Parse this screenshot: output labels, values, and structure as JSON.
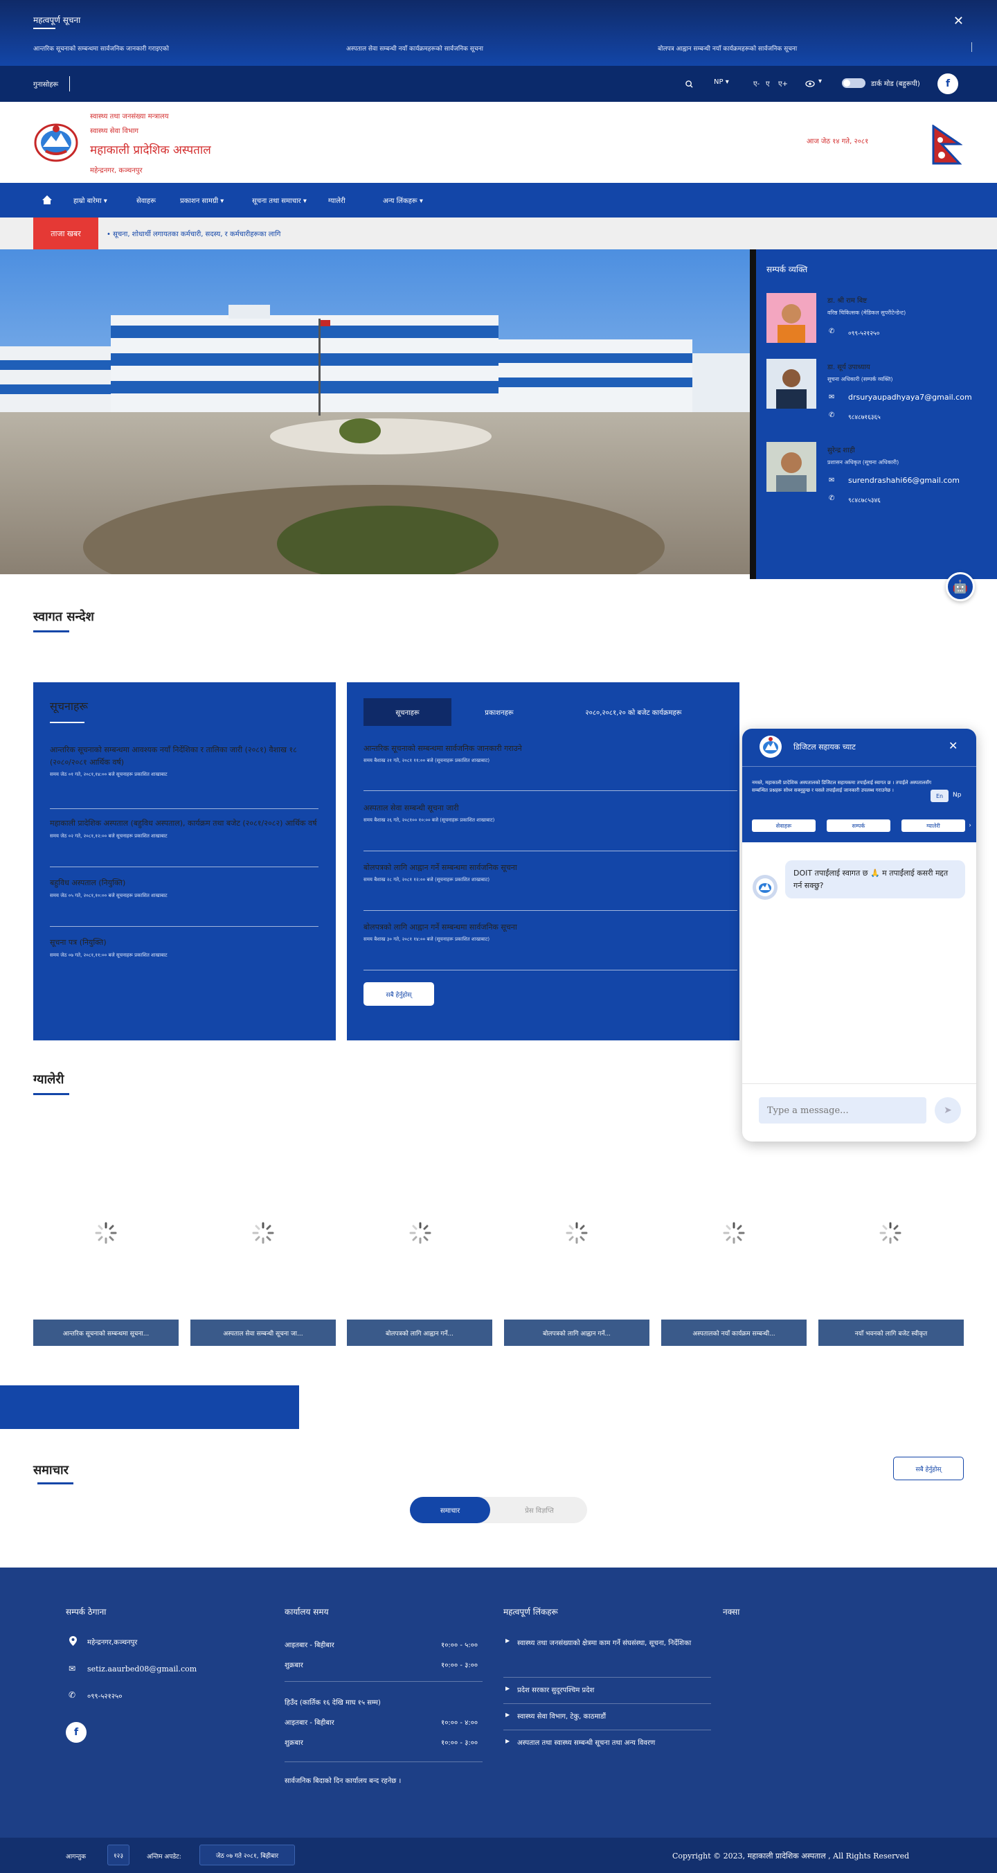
{
  "notice": {
    "title": "महत्वपूर्ण सूचना",
    "items": [
      "आन्तरिक सूचनाको सम्बन्धमा सार्वजनिक जानकारी गराइएको",
      "अस्पताल सेवा सम्बन्धी नयाँ कार्यक्रमहरूको सार्वजनिक सूचना",
      "बोलपत्र आह्वान सम्बन्धी नयाँ कार्यक्रमहरूको सार्वजनिक सूचना"
    ],
    "close": "✕"
  },
  "utility": {
    "left_label": "गुनासोहरू",
    "search_icon": "search-icon",
    "lang": "NP ▾",
    "font_sizes": [
      "ए-",
      "ए",
      "ए+"
    ],
    "eye_icon": "eye-icon",
    "toggle_label": "डार्क मोड (बहुरूपी)",
    "facebook": "f"
  },
  "header": {
    "line1": "स्वास्थ्य तथा जनसंख्या मन्त्रालय",
    "line2": "स्वास्थ्य सेवा विभाग",
    "title": "महाकाली प्रादेशिक अस्पताल",
    "location": "महेन्द्रनगर, कञ्चनपुर",
    "date": "आज जेठ १४ गते, २०८१"
  },
  "nav": {
    "home_icon": "home-icon",
    "items": [
      "हाम्रो बारेमा ▾",
      "सेवाहरू",
      "प्रकाशन सामग्री ▾",
      "सूचना तथा समाचार ▾",
      "ग्यालेरी",
      "अन्य लिंकहरू ▾"
    ]
  },
  "ticker": {
    "label": "ताजा खबर",
    "text": "• सूचना, शोधार्थी लगायतका कर्मचारी, सदस्य, र कर्मचारीहरूका लागि"
  },
  "side_panel": {
    "title": "सम्पर्क व्यक्ति",
    "people": [
      {
        "name": "डा. श्री राम बिष्ट",
        "role": "वरिष्ठ चिकित्सक (मेडिकल सुपरीटेन्डेन्ट)",
        "email": "",
        "phone": "०९९-५२१२५०"
      },
      {
        "name": "डा. सूर्य उपाध्याय",
        "role": "सूचना अधिकारी (सम्पर्क व्यक्ति)",
        "email": "drsuryaupadhyaya7@gmail.com",
        "phone": "९८४८७१६३६५"
      },
      {
        "name": "सुरेन्द्र शाही",
        "role": "प्रशासन अधिकृत (सूचना अधिकारी)",
        "email": "surendrashahi66@gmail.com",
        "phone": "९८४८७८५३४६"
      }
    ]
  },
  "welcome": {
    "title": "स्वागत सन्देश"
  },
  "notices_panel": {
    "title": "सूचनाहरू",
    "items": [
      {
        "head": "आन्तरिक सूचनाको सम्बन्धमा आवश्यक नयाँ निर्देशिका र तालिका जारी (२०८१) वैशाख १८ (२०८०/२०८१ आर्थिक वर्ष)",
        "meta": "समय जेठ ०१ गते, २०८१,१४:०० बजे    सूचनाहरू प्रकाशित शाखाबाट"
      },
      {
        "head": "महाकाली प्रादेशिक अस्पताल (बहुविध अस्पताल), कार्यक्रम तथा बजेट (२०८१/२०८२) आर्थिक वर्ष",
        "meta": "समय जेठ ०२ गते, २०८१,१२:०० बजे    सूचनाहरू प्रकाशित शाखाबाट"
      },
      {
        "head": "बहुविध अस्पताल (नियुक्ति)",
        "meta": "समय जेठ ०५ गते, २०८१,१०:०० बजे    सूचनाहरू प्रकाशित शाखाबाट"
      },
      {
        "head": "सूचना पत्र (नियुक्ति)",
        "meta": "समय जेठ ०७ गते, २०८१,११:०० बजे    सूचनाहरू प्रकाशित शाखाबाट"
      }
    ]
  },
  "tabs_panel": {
    "tabs": [
      "सूचनाहरू",
      "प्रकाशनहरू",
      "२०८०,२०८१,२० को बजेट कार्यक्रमहरू"
    ],
    "items": [
      {
        "head": "आन्तरिक सूचनाको सम्बन्धमा सार्वजनिक जानकारी गराउने",
        "meta": "समय बैशाख २१ गते, २०८१ ११:०० बजे (सूचनाहरू प्रकाशित शाखाबाट)"
      },
      {
        "head": "अस्पताल सेवा सम्बन्धी सूचना जारी",
        "meta": "समय बैशाख २६ गते, २०८१०० १०:०० बजे (सूचनाहरू प्रकाशित शाखाबाट)"
      },
      {
        "head": "बोलपत्रको लागि आह्वान गर्ने सम्बन्धमा सार्वजनिक सूचना",
        "meta": "समय बैशाख २८ गते, २०८१ १२:०० बजे (सूचनाहरू प्रकाशित शाखाबाट)"
      },
      {
        "head": "बोलपत्रको लागि आह्वान गर्ने सम्बन्धमा सार्वजनिक सूचना",
        "meta": "समय बैशाख ३० गते, २०८१ १४:०० बजे (सूचनाहरू प्रकाशित शाखाबाट)"
      }
    ],
    "view_all": "सबै हेर्नुहोस्"
  },
  "gallery": {
    "title": "ग्यालेरी",
    "captions": [
      "आन्तरिक सूचनाको सम्बन्धमा सूचना...",
      "अस्पताल सेवा सम्बन्धी सूचना जा...",
      "बोलपत्रको लागि आह्वान गर्ने...",
      "बोलपत्रको लागि आह्वान गर्ने...",
      "अस्पतालको नयाँ कार्यक्रम सम्बन्धी...",
      "नयाँ भवनको लागि बजेट स्वीकृत"
    ]
  },
  "news": {
    "title": "समाचार",
    "view_all": "सबै हेर्नुहोस्",
    "pills": [
      "समाचार",
      "प्रेस विज्ञप्ति"
    ]
  },
  "footer": {
    "col1": {
      "title": "सम्पर्क ठेगाना",
      "address": "महेन्द्रनगर,कञ्चनपुर",
      "email": "setiz.aaurbed08@gmail.com",
      "phone": "०९९-५२१२५०"
    },
    "col2": {
      "title": "कार्यालय समय",
      "rows1": [
        [
          "आइतबार - बिहीबार",
          "१०:०० - ५:००"
        ],
        [
          "शुक्रबार",
          "१०:०० - ३:००"
        ]
      ],
      "winter": "हिउँद (कार्तिक १६ देखि माघ १५ सम्म)",
      "rows2": [
        [
          "आइतबार - बिहीबार",
          "१०:०० - ४:००"
        ],
        [
          "शुक्रबार",
          "१०:०० - ३:००"
        ]
      ],
      "note": "सार्वजनिक बिदाको दिन कार्यालय बन्द रहनेछ ।"
    },
    "col3": {
      "title": "महत्वपूर्ण लिंकहरू",
      "links": [
        "स्वास्थ्य तथा जनसंख्याको क्षेत्रमा काम गर्ने संघसंस्था, सूचना, निर्देशिका",
        "प्रदेश सरकार सुदूरपश्चिम प्रदेश",
        "स्वास्थ्य सेवा विभाग, टेकु, काठमाडौं",
        "अस्पताल तथा स्वास्थ्य सम्बन्धी सूचना तथा अन्य विवरण"
      ]
    },
    "col4": {
      "title": "नक्सा"
    }
  },
  "bottom": {
    "visitors_label": "आगन्तुक",
    "visitors_count": "१२३",
    "updated_label": "अन्तिम अपडेट:",
    "updated_value": "जेठ ०७ गते २०८१, बिहीबार",
    "copyright": "Copyright © 2023, महाकाली प्रादेशिक अस्पताल , All Rights Reserved"
  },
  "chat": {
    "title": "डिजिटल सहायक च्याट",
    "close": "✕",
    "desc": "नमस्ते, महाकाली प्रादेशिक अस्पतालको डिजिटल सहायकमा तपाईंलाई स्वागत छ । तपाईंले अस्पतालसँग सम्बन्धित प्रश्नहरू सोध्न सक्नुहुन्छ र यसले तपाईंलाई जानकारी उपलब्ध गराउनेछ ।",
    "lang_en": "En",
    "lang_np": "Np",
    "chips": [
      "सेवाहरू",
      "सम्पर्क",
      "ग्यालेरी"
    ],
    "message": "DOIT तपाईंलाई स्वागत छ 🙏 म तपाईंलाई कसरी मद्दत गर्न सक्छु?",
    "input_placeholder": "Type a message...",
    "send": "➤"
  },
  "colors": {
    "primary": "#1346a8",
    "dark": "#0f2a68",
    "alert": "#e53935",
    "footer": "#1d3f86"
  }
}
